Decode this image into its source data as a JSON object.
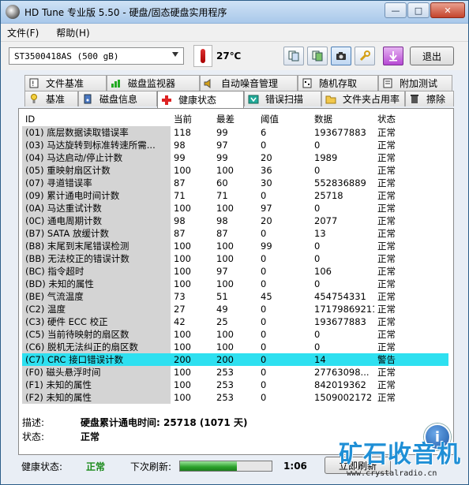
{
  "window": {
    "title": "HD Tune 专业版 5.50 - 硬盘/固态硬盘实用程序"
  },
  "menu": [
    "文件(F)",
    "帮助(H)"
  ],
  "toolbar": {
    "drive": "ST3500418AS (500 gB)",
    "temperature": "27℃",
    "exit_label": "退出"
  },
  "tabs_top": [
    {
      "label": "文件基准",
      "icon": "file-benchmark-icon"
    },
    {
      "label": "磁盘监视器",
      "icon": "disk-monitor-icon"
    },
    {
      "label": "自动噪音管理",
      "icon": "speaker-icon"
    },
    {
      "label": "随机存取",
      "icon": "random-access-icon"
    },
    {
      "label": "附加测试",
      "icon": "extra-tests-icon"
    }
  ],
  "tabs_bottom": [
    {
      "label": "基准",
      "icon": "benchmark-icon"
    },
    {
      "label": "磁盘信息",
      "icon": "disk-info-icon"
    },
    {
      "label": "健康状态",
      "icon": "health-cross-icon",
      "active": true
    },
    {
      "label": "错误扫描",
      "icon": "error-scan-icon"
    },
    {
      "label": "文件夹占用率",
      "icon": "folder-icon"
    },
    {
      "label": "擦除",
      "icon": "trash-icon"
    }
  ],
  "table": {
    "columns": [
      "ID",
      "当前",
      "最差",
      "阈值",
      "数据",
      "状态"
    ],
    "rows": [
      [
        "(01) 底层数据读取错误率",
        "118",
        "99",
        "6",
        "193677883",
        "正常"
      ],
      [
        "(03) 马达旋转到标准转速所需...",
        "98",
        "97",
        "0",
        "0",
        "正常"
      ],
      [
        "(04) 马达启动/停止计数",
        "99",
        "99",
        "20",
        "1989",
        "正常"
      ],
      [
        "(05) 重映射扇区计数",
        "100",
        "100",
        "36",
        "0",
        "正常"
      ],
      [
        "(07) 寻道错误率",
        "87",
        "60",
        "30",
        "552836889",
        "正常"
      ],
      [
        "(09) 累计通电时间计数",
        "71",
        "71",
        "0",
        "25718",
        "正常"
      ],
      [
        "(0A) 马达重试计数",
        "100",
        "100",
        "97",
        "0",
        "正常"
      ],
      [
        "(0C) 通电周期计数",
        "98",
        "98",
        "20",
        "2077",
        "正常"
      ],
      [
        "(B7) SATA 放缓计数",
        "87",
        "87",
        "0",
        "13",
        "正常"
      ],
      [
        "(B8) 末尾到末尾错误检测",
        "100",
        "100",
        "99",
        "0",
        "正常"
      ],
      [
        "(BB) 无法校正的错误计数",
        "100",
        "100",
        "0",
        "0",
        "正常"
      ],
      [
        "(BC) 指令超时",
        "100",
        "97",
        "0",
        "106",
        "正常"
      ],
      [
        "(BD) 未知的属性",
        "100",
        "100",
        "0",
        "0",
        "正常"
      ],
      [
        "(BE) 气流温度",
        "73",
        "51",
        "45",
        "454754331",
        "正常"
      ],
      [
        "(C2) 温度",
        "27",
        "49",
        "0",
        "17179869211",
        "正常"
      ],
      [
        "(C3) 硬件 ECC 校正",
        "42",
        "25",
        "0",
        "193677883",
        "正常"
      ],
      [
        "(C5) 当前待映射的扇区数",
        "100",
        "100",
        "0",
        "0",
        "正常"
      ],
      [
        "(C6) 脱机无法纠正的扇区数",
        "100",
        "100",
        "0",
        "0",
        "正常"
      ],
      [
        "(C7) CRC 接口错误计数",
        "200",
        "200",
        "0",
        "14",
        "警告"
      ],
      [
        "(F0) 磁头悬浮时间",
        "100",
        "253",
        "0",
        "27763098...",
        "正常"
      ],
      [
        "(F1) 未知的属性",
        "100",
        "253",
        "0",
        "842019362",
        "正常"
      ],
      [
        "(F2) 未知的属性",
        "100",
        "253",
        "0",
        "1509002172",
        "正常"
      ]
    ],
    "highlight_row": 18
  },
  "desc": {
    "desc_label": "描述:",
    "desc_value": "硬盘累计通电时间: 25718 (1071 天)",
    "status_label": "状态:",
    "status_value": "正常"
  },
  "statusbar": {
    "health_label": "健康状态:",
    "health_value": "正常",
    "next_refresh_label": "下次刷新:",
    "progress_fraction": 0.62,
    "countdown": "1:06",
    "refresh_button": "立即刷新"
  },
  "watermark": {
    "big": "矿石收音机",
    "url": "www.crystalradio.cn"
  },
  "colors": {
    "highlight": "#2ee0f0",
    "ok_green": "#1a8a1a",
    "id_column_bg": "#d4d4d4"
  }
}
